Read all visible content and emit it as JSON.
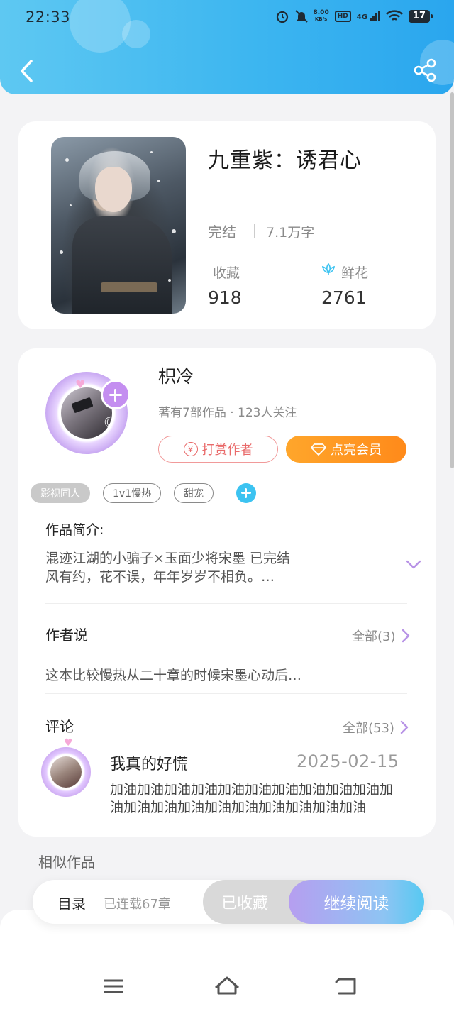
{
  "status_bar": {
    "time": "22:33",
    "net_speed": "8.00",
    "net_unit": "KB/s",
    "hd": "HD",
    "network": "4G",
    "battery": "17"
  },
  "book": {
    "title": "九重紫：诱君心",
    "status": "完结",
    "word_count": "7.1万字",
    "favorites_label": "收藏",
    "favorites_value": "918",
    "flowers_label": "鲜花",
    "flowers_value": "2761"
  },
  "author": {
    "name": "枳冷",
    "meta": "著有7部作品 · 123人关注",
    "tip_label": "打赏作者",
    "vip_label": "点亮会员"
  },
  "tags": [
    "影视同人",
    "1v1慢热",
    "甜宠"
  ],
  "intro": {
    "title": "作品简介:",
    "line1": "混迹江湖的小骗子×玉面少将宋墨   已完结",
    "line2": "风有约，花不误，年年岁岁不相负。…"
  },
  "author_say": {
    "title": "作者说",
    "see_all": "全部(3)",
    "text": "这本比较慢热从二十章的时候宋墨心动后…"
  },
  "comments": {
    "title": "评论",
    "see_all": "全部(53)",
    "name": "我真的好慌",
    "date": "2025-02-15",
    "text": "加油加油加油加油加油加油加油加油加油加油加油加油加油加油加油加油加油加油加油加油"
  },
  "similar": "相似作品",
  "action_bar": {
    "toc": "目录",
    "serial": "已连载67章",
    "favorited": "已收藏",
    "continue": "继续阅读"
  },
  "colors": {
    "header_blue": "#3db6f0",
    "accent_purple": "#c48ef0",
    "vip_orange": "#ff8a1a",
    "tip_red": "#e96b6b"
  }
}
